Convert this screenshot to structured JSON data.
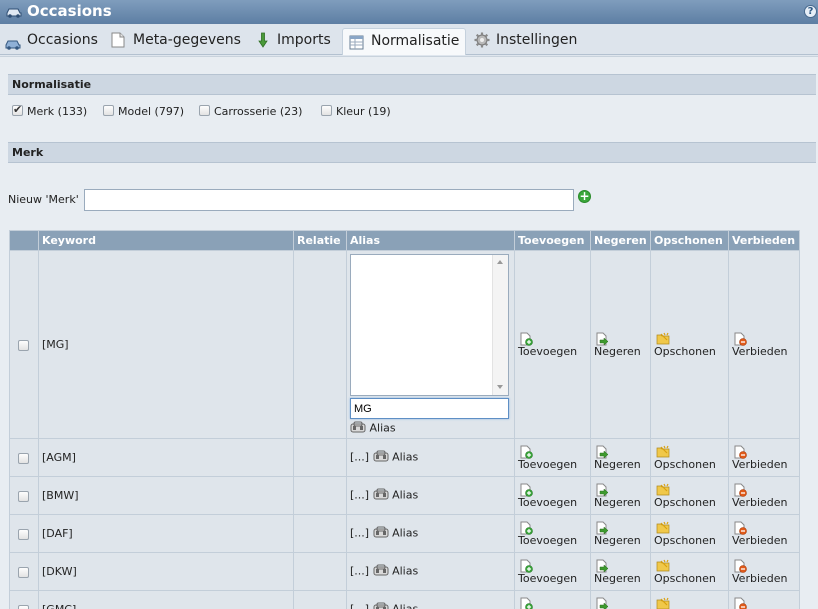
{
  "window": {
    "title": "Occasions",
    "help_icon": "help-icon"
  },
  "tabs": [
    {
      "label": "Occasions",
      "icon": "car-icon"
    },
    {
      "label": "Meta-gegevens",
      "icon": "document-icon"
    },
    {
      "label": "Imports",
      "icon": "download-arrow-icon"
    },
    {
      "label": "Normalisatie",
      "icon": "table-icon",
      "active": true
    },
    {
      "label": "Instellingen",
      "icon": "gear-icon"
    }
  ],
  "normalisatie": {
    "header": "Normalisatie",
    "filters": [
      {
        "label": "Merk (133)",
        "checked": true
      },
      {
        "label": "Model (797)",
        "checked": false
      },
      {
        "label": "Carrosserie (23)",
        "checked": false
      },
      {
        "label": "Kleur (19)",
        "checked": false
      }
    ]
  },
  "merk": {
    "header": "Merk",
    "new_label": "Nieuw 'Merk'",
    "new_value": ""
  },
  "grid": {
    "columns": [
      "",
      "Keyword",
      "Relatie",
      "Alias",
      "Toevoegen",
      "Negeren",
      "Opschonen",
      "Verbieden"
    ],
    "actions": {
      "toevoegen": "Toevoegen",
      "negeren": "Negeren",
      "opschonen": "Opschonen",
      "verbieden": "Verbieden",
      "alias": "Alias",
      "ellipsis": "[...]"
    },
    "first_row": {
      "keyword": "[MG]",
      "alias_input": "MG"
    },
    "rows": [
      {
        "keyword": "[AGM]"
      },
      {
        "keyword": "[BMW]"
      },
      {
        "keyword": "[DAF]"
      },
      {
        "keyword": "[DKW]"
      },
      {
        "keyword": "[GMC]"
      }
    ]
  },
  "colors": {
    "header_bar": "#8aa1b7",
    "section_bar": "#cdd7e2",
    "title_bar": "#6c8bb0",
    "add_green": "#3aa63a"
  }
}
